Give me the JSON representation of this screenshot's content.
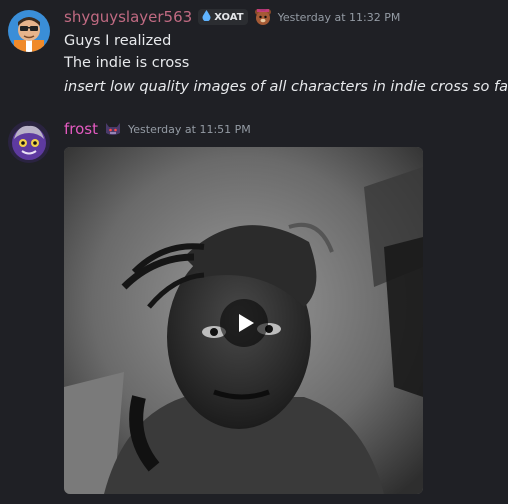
{
  "messages": [
    {
      "username": "shyguyslayer563",
      "username_color": "#c06a82",
      "tag": "XOAT",
      "timestamp": "Yesterday at 11:32 PM",
      "lines": [
        "Guys I realized",
        "The indie is cross",
        "insert low quality images of all characters in indie cross so far"
      ]
    },
    {
      "username": "frost",
      "username_color": "#e35ac0",
      "timestamp": "Yesterday at 11:51 PM",
      "attachment": {
        "type": "video",
        "icon": "play-icon"
      }
    }
  ],
  "colors": {
    "background": "#1f2025",
    "timestamp": "#949ba4",
    "text": "#e7e9ec"
  }
}
